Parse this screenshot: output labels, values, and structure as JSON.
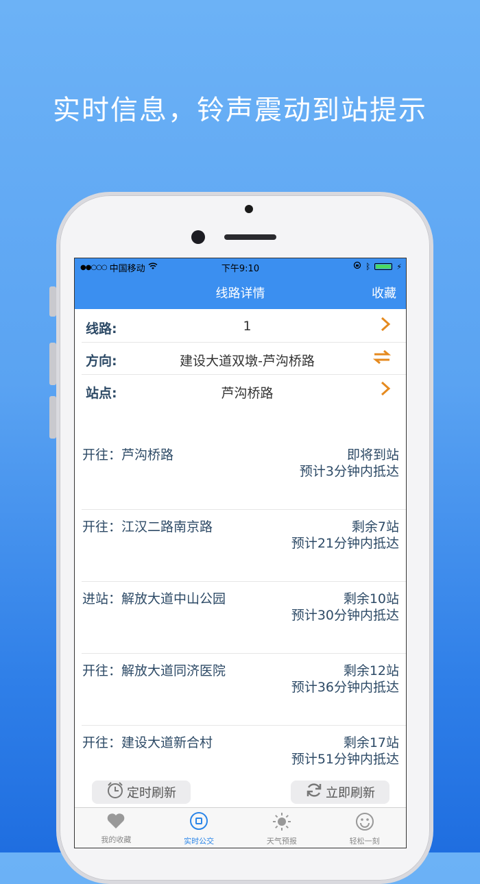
{
  "headline": "实时信息，铃声震动到站提示",
  "status_bar": {
    "carrier": "中国移动",
    "time": "下午9:10"
  },
  "navbar": {
    "title": "线路详情",
    "favorite_label": "收藏"
  },
  "info": {
    "route_label": "线路:",
    "route_value": "1",
    "direction_label": "方向:",
    "direction_value": "建设大道双墩-芦沟桥路",
    "station_label": "站点:",
    "station_value": "芦沟桥路"
  },
  "buses": [
    {
      "stop": "开往：芦沟桥路",
      "remain": "即将到站",
      "eta": "预计3分钟内抵达"
    },
    {
      "stop": "开往：江汉二路南京路",
      "remain": "剩余7站",
      "eta": "预计21分钟内抵达"
    },
    {
      "stop": "进站：解放大道中山公园",
      "remain": "剩余10站",
      "eta": "预计30分钟内抵达"
    },
    {
      "stop": "开往：解放大道同济医院",
      "remain": "剩余12站",
      "eta": "预计36分钟内抵达"
    },
    {
      "stop": "开往：建设大道新合村",
      "remain": "剩余17站",
      "eta": "预计51分钟内抵达"
    }
  ],
  "buttons": {
    "timed_refresh": "定时刷新",
    "refresh_now": "立即刷新"
  },
  "tabs": [
    {
      "label": "我的收藏",
      "icon": "heart-icon"
    },
    {
      "label": "实时公交",
      "icon": "bus-icon"
    },
    {
      "label": "天气预报",
      "icon": "sun-icon"
    },
    {
      "label": "轻松一刻",
      "icon": "smile-icon"
    }
  ],
  "colors": {
    "accent": "#3b8ff0",
    "icon_orange": "#e58a1f",
    "active_tab": "#2a85e8"
  }
}
